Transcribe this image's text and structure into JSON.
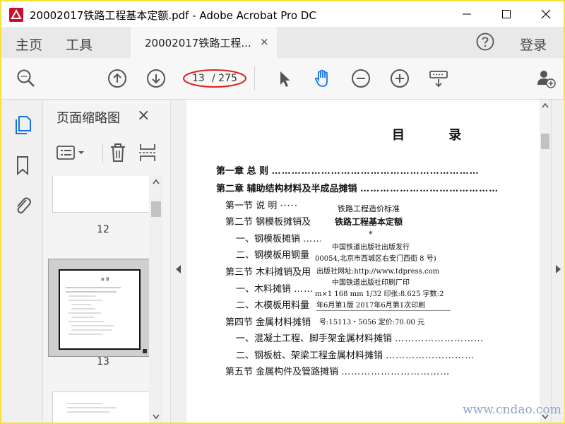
{
  "window": {
    "title": "20002017铁路工程基本定额.pdf - Adobe Acrobat Pro DC",
    "minimize_icon": "minimize-icon",
    "maximize_icon": "maximize-icon",
    "close_icon": "close-icon"
  },
  "menu": {
    "home": "主页",
    "tools": "工具",
    "tab_label": "20002017铁路工程...",
    "tab_close": "×",
    "login": "登录"
  },
  "toolbar": {
    "page_current": "13",
    "page_total": "/ 275",
    "icons": [
      "zoom-search-icon",
      "page-up-icon",
      "page-down-icon",
      "select-arrow-icon",
      "hand-tool-icon",
      "zoom-out-icon",
      "zoom-in-icon",
      "keyboard-scroll-icon",
      "share-user-icon"
    ],
    "highlight_color": "#e02020",
    "hand_color": "#1473e6"
  },
  "thumbnails": {
    "title": "页面缩略图",
    "close": "×",
    "pages": [
      {
        "number": "12"
      },
      {
        "number": "13",
        "selected": true
      }
    ]
  },
  "document": {
    "heading": "目 录",
    "toc": [
      {
        "text": "第一章 总 则",
        "bold": true
      },
      {
        "text": "第二章 辅助结构材料及半成品摊销",
        "bold": true
      },
      {
        "text": "第一节 说 明",
        "bold": false
      },
      {
        "text": "第二节 钢模板摊销及",
        "bold": false
      },
      {
        "text": "一、钢模板摊销",
        "bold": false
      },
      {
        "text": "二、钢模板用钢量",
        "bold": false
      },
      {
        "text": "第三节 木料摊销及用",
        "bold": false
      },
      {
        "text": "一、木料摊销",
        "bold": false
      },
      {
        "text": "二、木模板用料量",
        "bold": false
      },
      {
        "text": "第四节 金属材料摊销",
        "bold": false
      },
      {
        "text": "一、混凝土工程、脚手架金属材料摊销",
        "bold": false
      },
      {
        "text": "二、钢板桩、架梁工程金属材料摊销",
        "bold": false
      },
      {
        "text": "第五节 金属构件及管路摊销",
        "bold": false
      }
    ],
    "colophon": [
      "铁路工程造价标准",
      "铁路工程基本定额",
      "*",
      "中国铁道出版社出版发行",
      "00054,北京市西城区右安门西街 8 号)",
      "出版社网址:http://www.tdpress.com",
      "中国铁道出版社印刷厂印",
      "m×1 168 mm  1/32  印张:8.625  字数:2",
      "年6月第1版  2017年6月第1次印刷",
      "号:15113・5056    定价:70.00 元"
    ]
  },
  "watermark": "www.cndao.com"
}
